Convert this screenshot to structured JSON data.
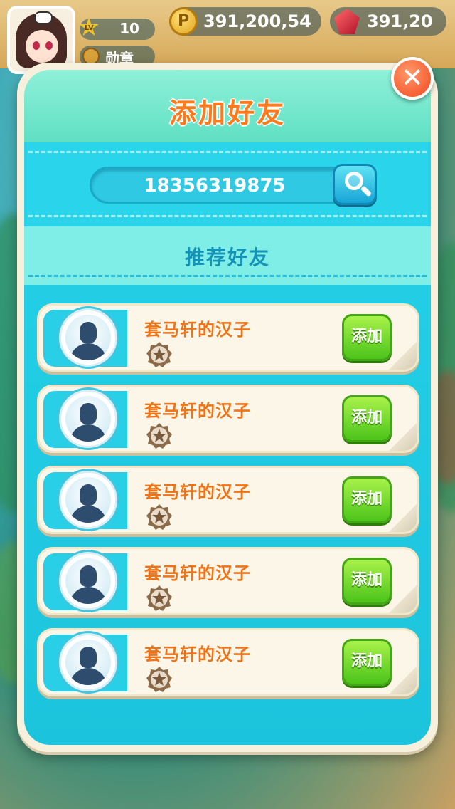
{
  "hud": {
    "level_tag": "LV",
    "level": "10",
    "medal_label": "勋章",
    "coins": "391,200,54",
    "coin_symbol": "P",
    "gems": "391,20"
  },
  "dialog": {
    "title": "添加好友",
    "close_symbol": "✕",
    "search_value": "18356319875",
    "recommend_label": "推荐好友",
    "friends": [
      {
        "name": "套马轩的汉子",
        "add_label": "添加"
      },
      {
        "name": "套马轩的汉子",
        "add_label": "添加"
      },
      {
        "name": "套马轩的汉子",
        "add_label": "添加"
      },
      {
        "name": "套马轩的汉子",
        "add_label": "添加"
      },
      {
        "name": "套马轩的汉子",
        "add_label": "添加"
      }
    ]
  },
  "colors": {
    "title_orange": "#ff7a1a",
    "name_orange": "#ef7418",
    "panel_cyan": "#25d2e8",
    "header_mint": "#8ff0d8",
    "add_green": "#4cc41a",
    "close_red": "#f2471f"
  },
  "icons": [
    "player-avatar",
    "level-star-icon",
    "medal-icon",
    "coin-icon",
    "gem-icon",
    "close-icon",
    "search-icon",
    "default-avatar-icon",
    "rank-badge-icon"
  ]
}
